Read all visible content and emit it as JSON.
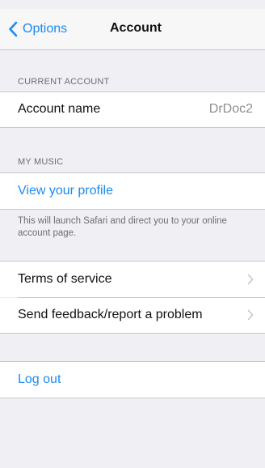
{
  "navbar": {
    "back_label": "Options",
    "title": "Account"
  },
  "current_account": {
    "header": "CURRENT ACCOUNT",
    "account_name_label": "Account name",
    "account_name_value": "DrDoc2"
  },
  "my_music": {
    "header": "MY MUSIC",
    "view_profile_label": "View your profile",
    "note": "This will launch Safari and direct you to your online account page."
  },
  "menu": {
    "terms_label": "Terms of service",
    "feedback_label": "Send feedback/report a problem"
  },
  "logout": {
    "label": "Log out"
  },
  "colors": {
    "accent": "#1a8bf2",
    "background": "#efeff4",
    "separator": "#c8c7cc"
  },
  "icons": {
    "back": "chevron-left-icon",
    "row_disclosure": "chevron-right-icon"
  }
}
